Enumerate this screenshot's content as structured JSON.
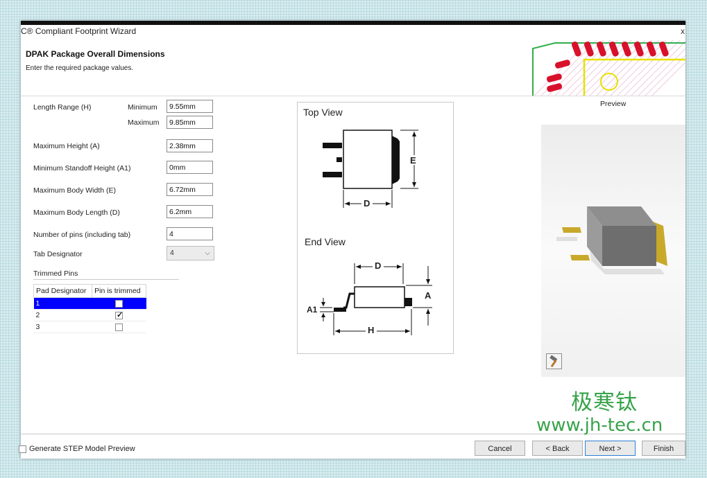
{
  "window": {
    "title": "C® Compliant Footprint Wizard",
    "close_glyph": "x"
  },
  "page": {
    "title": "DPAK Package Overall Dimensions",
    "subtitle": "Enter the required package values."
  },
  "form": {
    "length_range_label": "Length Range (H)",
    "minimum_label": "Minimum",
    "minimum_value": "9.55mm",
    "maximum_label": "Maximum",
    "maximum_value": "9.85mm",
    "max_height_label": "Maximum Height (A)",
    "max_height_value": "2.38mm",
    "min_standoff_label": "Minimum Standoff Height (A1)",
    "min_standoff_value": "0mm",
    "max_body_width_label": "Maximum Body Width (E)",
    "max_body_width_value": "6.72mm",
    "max_body_length_label": "Maximum Body Length (D)",
    "max_body_length_value": "6.2mm",
    "num_pins_label": "Number of pins (including tab)",
    "num_pins_value": "4",
    "tab_designator_label": "Tab Designator",
    "tab_designator_value": "4"
  },
  "trimmed_pins": {
    "title": "Trimmed Pins",
    "headers": [
      "Pad Designator",
      "Pin is trimmed"
    ],
    "rows": [
      {
        "designator": "1",
        "trimmed": false,
        "selected": true
      },
      {
        "designator": "2",
        "trimmed": true,
        "selected": false
      },
      {
        "designator": "3",
        "trimmed": false,
        "selected": false
      }
    ]
  },
  "diagram": {
    "top_view_label": "Top View",
    "end_view_label": "End View",
    "dim_E": "E",
    "dim_D": "D",
    "dim_A": "A",
    "dim_A1": "A1",
    "dim_H": "H"
  },
  "preview": {
    "label": "Preview",
    "tool_icon": "hammer-icon"
  },
  "footer": {
    "step_preview_label": "Generate STEP Model Preview",
    "step_preview_checked": false,
    "cancel_label": "Cancel",
    "back_label": "< Back",
    "next_label": "Next >",
    "finish_label": "Finish"
  },
  "watermark": {
    "chinese": "极寒钛",
    "url": "www.jh-tec.cn"
  },
  "colors": {
    "selection_blue": "#0000ff",
    "pcb_pad_red": "#d8102a",
    "pcb_trace_green": "#2fae4a",
    "pad_gold": "#c8a92a",
    "watermark_green": "#37a34a"
  }
}
